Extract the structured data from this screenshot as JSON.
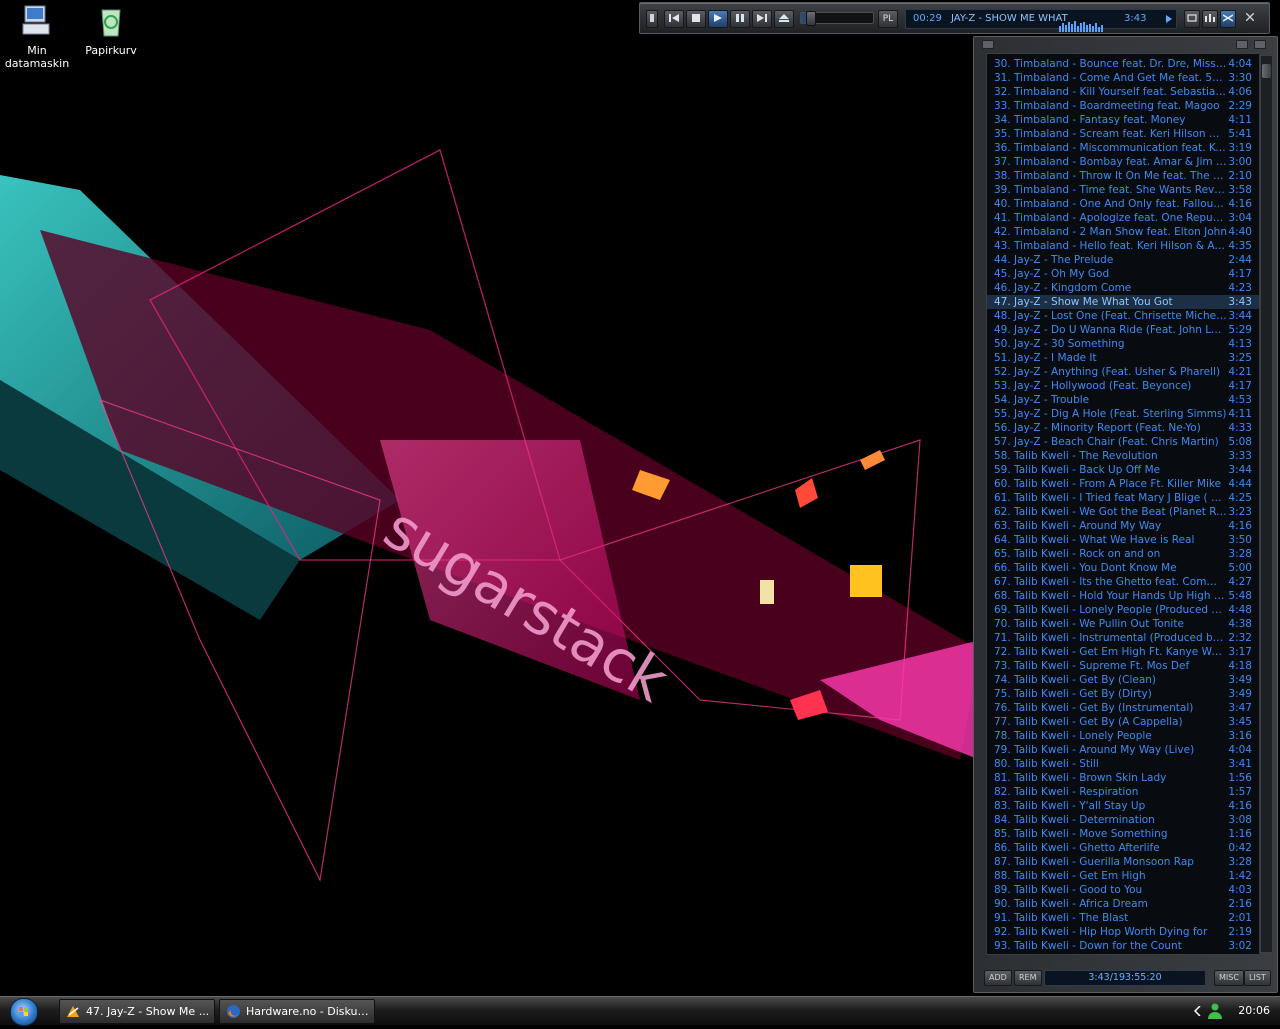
{
  "desktop": {
    "icons": [
      {
        "label": "Min datamaskin",
        "icon": "computer-icon"
      },
      {
        "label": "Papirkurv",
        "icon": "recycle-bin-icon"
      }
    ],
    "wallpaper_text": "sugarstack",
    "colors": {
      "accent_pink": "#ff2d8a",
      "accent_teal": "#27c7c9"
    }
  },
  "player": {
    "buttons": {
      "prev": "previous",
      "play": "play",
      "pause": "pause",
      "stop": "stop",
      "next": "next",
      "eject": "eject"
    },
    "pl_label": "PL",
    "elapsed": "00:29",
    "track_title": "JAY-Z - SHOW ME WHAT",
    "duration": "3:43",
    "seek_fraction": 0.13
  },
  "playlist": {
    "items": [
      {
        "title": "30. Timbaland - Bounce feat. Dr. Dre, Missy Elli...",
        "duration": "4:04"
      },
      {
        "title": "31. Timbaland - Come And Get Me feat. 50 Ce...",
        "duration": "3:30"
      },
      {
        "title": "32. Timbaland - Kill Yourself feat. Sebastian & ...",
        "duration": "4:06"
      },
      {
        "title": "33. Timbaland - Boardmeeting feat. Magoo",
        "duration": "2:29"
      },
      {
        "title": "34. Timbaland - Fantasy feat. Money",
        "duration": "4:11"
      },
      {
        "title": "35. Timbaland - Scream feat. Keri Hilson & Nic...",
        "duration": "5:41"
      },
      {
        "title": "36. Timbaland - Miscommunication feat. Keri Hil...",
        "duration": "3:19"
      },
      {
        "title": "37. Timbaland - Bombay feat. Amar & Jim Beanz",
        "duration": "3:00"
      },
      {
        "title": "38. Timbaland - Throw It On Me feat. The Hives",
        "duration": "2:10"
      },
      {
        "title": "39. Timbaland - Time feat. She Wants Revenge",
        "duration": "3:58"
      },
      {
        "title": "40. Timbaland - One And Only feat. Fallout Boy",
        "duration": "4:16"
      },
      {
        "title": "41. Timbaland - Apologize feat. One Republic",
        "duration": "3:04"
      },
      {
        "title": "42. Timbaland - 2 Man Show feat. Elton John",
        "duration": "4:40"
      },
      {
        "title": "43. Timbaland - Hello feat. Keri Hilson & Attitud...",
        "duration": "4:35"
      },
      {
        "title": "44. Jay-Z - The Prelude",
        "duration": "2:44"
      },
      {
        "title": "45. Jay-Z - Oh My God",
        "duration": "4:17"
      },
      {
        "title": "46. Jay-Z - Kingdom Come",
        "duration": "4:23"
      },
      {
        "title": "47. Jay-Z - Show Me What You Got",
        "duration": "3:43"
      },
      {
        "title": "48. Jay-Z - Lost One (Feat. Chrisette Michele)",
        "duration": "3:44"
      },
      {
        "title": "49. Jay-Z - Do U Wanna Ride (Feat. John Lege...",
        "duration": "5:29"
      },
      {
        "title": "50. Jay-Z - 30 Something",
        "duration": "4:13"
      },
      {
        "title": "51. Jay-Z - I Made It",
        "duration": "3:25"
      },
      {
        "title": "52. Jay-Z - Anything (Feat. Usher & Pharell)",
        "duration": "4:21"
      },
      {
        "title": "53. Jay-Z - Hollywood (Feat. Beyonce)",
        "duration": "4:17"
      },
      {
        "title": "54. Jay-Z - Trouble",
        "duration": "4:53"
      },
      {
        "title": "55. Jay-Z - Dig A Hole (Feat. Sterling Simms)",
        "duration": "4:11"
      },
      {
        "title": "56. Jay-Z - Minority Report (Feat. Ne-Yo)",
        "duration": "4:33"
      },
      {
        "title": "57. Jay-Z - Beach Chair (Feat. Chris Martin)",
        "duration": "5:08"
      },
      {
        "title": "58. Talib Kweli - The Revolution",
        "duration": "3:33"
      },
      {
        "title": "59. Talib Kweli - Back Up Off Me",
        "duration": "3:44"
      },
      {
        "title": "60. Talib Kweli - From A Place Ft. Killer Mike",
        "duration": "4:44"
      },
      {
        "title": "61. Talib Kweli - I Tried feat Mary J Blige ( Prod...",
        "duration": "4:25"
      },
      {
        "title": "62. Talib Kweli - We Got the Beat (Planet Rock)",
        "duration": "3:23"
      },
      {
        "title": "63. Talib Kweli - Around My Way",
        "duration": "4:16"
      },
      {
        "title": "64. Talib Kweli - What We Have is Real",
        "duration": "3:50"
      },
      {
        "title": "65. Talib Kweli - Rock on and on",
        "duration": "3:28"
      },
      {
        "title": "66. Talib Kweli - You Dont Know Me",
        "duration": "5:00"
      },
      {
        "title": "67. Talib Kweli - Its the Ghetto feat. Common",
        "duration": "4:27"
      },
      {
        "title": "68. Talib Kweli - Hold Your Hands Up High Ft. ...",
        "duration": "5:48"
      },
      {
        "title": "69. Talib Kweli - Lonely People (Produced by ...",
        "duration": "4:48"
      },
      {
        "title": "70. Talib Kweli - We Pullin Out Tonite",
        "duration": "4:38"
      },
      {
        "title": "71. Talib Kweli - Instrumental (Produced by Ka...",
        "duration": "2:32"
      },
      {
        "title": "72. Talib Kweli - Get Em High Ft. Kanye West",
        "duration": "3:17"
      },
      {
        "title": "73. Talib Kweli - Supreme Ft. Mos Def",
        "duration": "4:18"
      },
      {
        "title": "74. Talib Kweli - Get By (Clean)",
        "duration": "3:49"
      },
      {
        "title": "75. Talib Kweli - Get By (Dirty)",
        "duration": "3:49"
      },
      {
        "title": "76. Talib Kweli - Get By (Instrumental)",
        "duration": "3:47"
      },
      {
        "title": "77. Talib Kweli - Get By (A Cappella)",
        "duration": "3:45"
      },
      {
        "title": "78. Talib Kweli - Lonely People",
        "duration": "3:16"
      },
      {
        "title": "79. Talib Kweli - Around My Way (Live)",
        "duration": "4:04"
      },
      {
        "title": "80. Talib Kweli - Still",
        "duration": "3:41"
      },
      {
        "title": "81. Talib Kweli - Brown Skin Lady",
        "duration": "1:56"
      },
      {
        "title": "82. Talib Kweli - Respiration",
        "duration": "1:57"
      },
      {
        "title": "83. Talib Kweli - Y'all Stay Up",
        "duration": "4:16"
      },
      {
        "title": "84. Talib Kweli - Determination",
        "duration": "3:08"
      },
      {
        "title": "85. Talib Kweli - Move Something",
        "duration": "1:16"
      },
      {
        "title": "86. Talib Kweli - Ghetto Afterlife",
        "duration": "0:42"
      },
      {
        "title": "87. Talib Kweli - Guerilla Monsoon Rap",
        "duration": "3:28"
      },
      {
        "title": "88. Talib Kweli - Get Em High",
        "duration": "1:42"
      },
      {
        "title": "89. Talib Kweli - Good to You",
        "duration": "4:03"
      },
      {
        "title": "90. Talib Kweli - Africa Dream",
        "duration": "2:16"
      },
      {
        "title": "91. Talib Kweli - The Blast",
        "duration": "2:01"
      },
      {
        "title": "92. Talib Kweli - Hip Hop Worth Dying for",
        "duration": "2:19"
      },
      {
        "title": "93. Talib Kweli - Down for the Count",
        "duration": "3:02"
      }
    ],
    "current_index": 17,
    "add_label": "ADD",
    "rem_label": "REM",
    "total_time": "3:43/193:55:20",
    "misc_label": "MISC",
    "list_label": "LIST"
  },
  "taskbar": {
    "tasks": [
      {
        "label": "47. Jay-Z - Show Me ...",
        "icon": "winamp-icon"
      },
      {
        "label": "Hardware.no - Diskus...",
        "icon": "firefox-icon"
      }
    ],
    "clock": "20:06"
  }
}
